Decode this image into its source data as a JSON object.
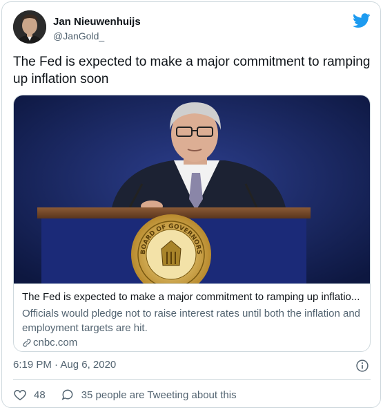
{
  "author": {
    "name": "Jan Nieuwenhuijs",
    "handle": "@JanGold_"
  },
  "tweet": {
    "text": "The Fed is expected to make a major commitment to ramping up inflation soon"
  },
  "card": {
    "title": "The Fed is expected to make a major commitment to ramping up inflatio...",
    "description": "Officials would pledge not to raise interest rates until both the inflation and employment targets are hit.",
    "domain": "cnbc.com",
    "seal_text": "BOARD OF GOVERNORS"
  },
  "meta": {
    "timestamp": "6:19 PM · Aug 6, 2020"
  },
  "actions": {
    "likes": "48",
    "talking": "35 people are Tweeting about this"
  },
  "colors": {
    "twitter_blue": "#1d9bf0",
    "secondary_text": "#536471",
    "border": "#cfd9de"
  },
  "icons": {
    "brand": "twitter-bird-icon",
    "info": "info-icon",
    "like": "heart-icon",
    "talk": "speech-bubble-icon",
    "link": "link-icon"
  }
}
